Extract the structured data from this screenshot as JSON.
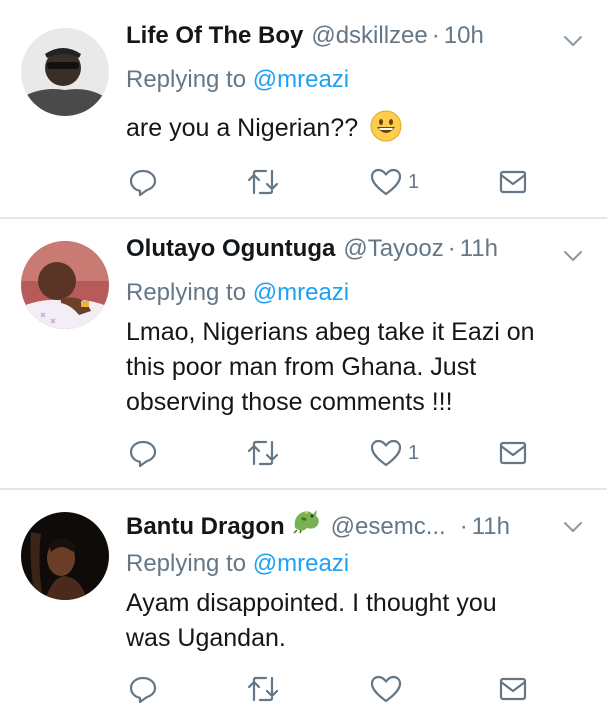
{
  "tweets": [
    {
      "name": "Life Of The Boy",
      "handle": "@dskillzee",
      "dot": "·",
      "time": "10h",
      "reply_prefix": "Replying to",
      "reply_to": "@mreazi",
      "text": "are you a Nigerian??",
      "like_count": "1",
      "emoji": "grinning-face"
    },
    {
      "name": "Olutayo Oguntuga",
      "handle": "@Tayooz",
      "dot": "·",
      "time": "11h",
      "reply_prefix": "Replying to",
      "reply_to": "@mreazi",
      "text_lines": [
        "Lmao, Nigerians abeg take it Eazi on",
        "this poor man from Ghana. Just",
        "observing those comments !!!"
      ],
      "like_count": "1"
    },
    {
      "name": "Bantu Dragon",
      "handle": "@esemc...",
      "dot": "·",
      "time": "11h",
      "reply_prefix": "Replying to",
      "reply_to": "@mreazi",
      "text_lines": [
        "Ayam disappointed. I thought you",
        "was Ugandan."
      ],
      "like_count": "",
      "name_emoji": "dragon"
    }
  ],
  "colors": {
    "text": "#14171a",
    "secondary": "#657786",
    "link": "#1da1f2",
    "divider": "#e1e8ed"
  },
  "icons": [
    "reply-icon",
    "retweet-icon",
    "like-icon",
    "dm-icon",
    "chevron-down-icon"
  ]
}
